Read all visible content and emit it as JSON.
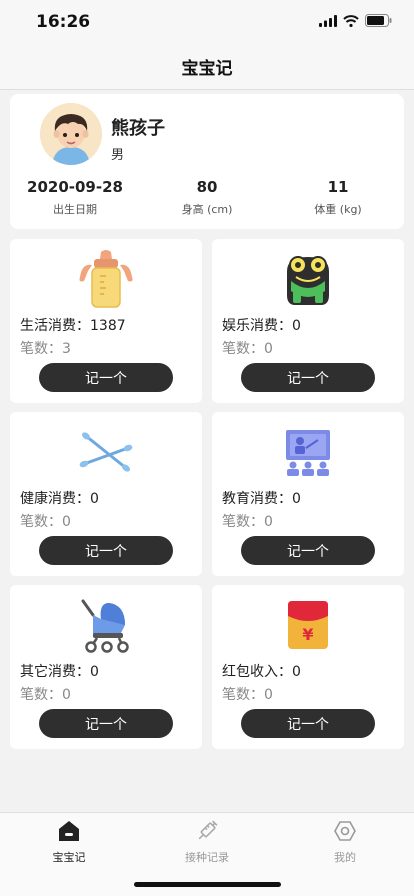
{
  "status_bar": {
    "time": "16:26"
  },
  "nav": {
    "title": "宝宝记"
  },
  "profile": {
    "name": "熊孩子",
    "gender": "男",
    "stats": [
      {
        "value": "2020-09-28",
        "label": "出生日期"
      },
      {
        "value": "80",
        "label": "身高 (cm)"
      },
      {
        "value": "11",
        "label": "体重 (kg)"
      }
    ]
  },
  "categories": [
    {
      "title": "生活消费：1387",
      "count": "笔数：3",
      "button": "记一个",
      "icon": "baby-bottle-icon"
    },
    {
      "title": "娱乐消费：0",
      "count": "笔数：0",
      "button": "记一个",
      "icon": "frog-toy-icon"
    },
    {
      "title": "健康消费：0",
      "count": "笔数：0",
      "button": "记一个",
      "icon": "cotton-swab-icon"
    },
    {
      "title": "教育消费：0",
      "count": "笔数：0",
      "button": "记一个",
      "icon": "classroom-icon"
    },
    {
      "title": "其它消费：0",
      "count": "笔数：0",
      "button": "记一个",
      "icon": "stroller-icon"
    },
    {
      "title": "红包收入：0",
      "count": "笔数：0",
      "button": "记一个",
      "icon": "red-envelope-icon"
    }
  ],
  "tabs": [
    {
      "label": "宝宝记",
      "icon": "house-icon",
      "active": true
    },
    {
      "label": "接种记录",
      "icon": "syringe-icon",
      "active": false
    },
    {
      "label": "我的",
      "icon": "profile-hexagon-icon",
      "active": false
    }
  ],
  "colors": {
    "button": "#2f2f2f",
    "active_tab": "#222222",
    "inactive_tab": "#999999",
    "count_text": "#888888"
  }
}
